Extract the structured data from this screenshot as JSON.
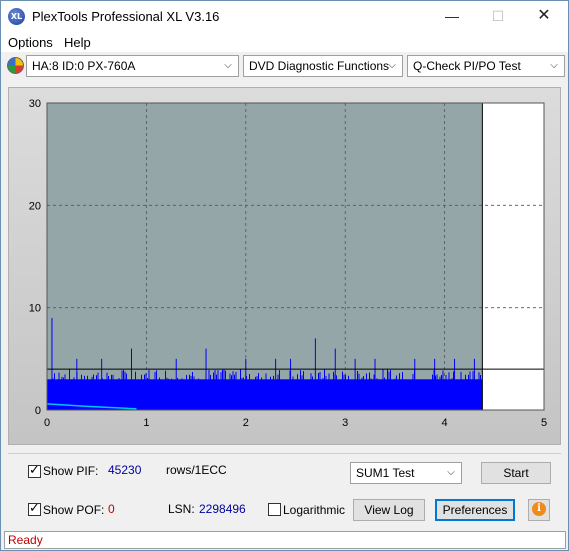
{
  "window": {
    "title": "PlexTools Professional XL V3.16",
    "icon_text": "XL",
    "minimize": "—",
    "maximize": "☐",
    "close": "✕"
  },
  "menu": {
    "options": "Options",
    "help": "Help"
  },
  "toolbar": {
    "drive": "HA:8 ID:0  PX-760A",
    "function": "DVD Diagnostic Functions",
    "test": "Q-Check PI/PO Test",
    "chevron": "⌵"
  },
  "chart_data": {
    "type": "bar",
    "title": "",
    "xlabel": "",
    "ylabel": "",
    "xlim": [
      0,
      5
    ],
    "ylim": [
      0,
      30
    ],
    "x_ticks": [
      "0",
      "1",
      "2",
      "3",
      "4",
      "5"
    ],
    "y_ticks": [
      "0",
      "10",
      "20",
      "30"
    ],
    "grid": true,
    "data_end_x": 4.38,
    "threshold_y": 4,
    "series": [
      {
        "color": "#0000ff",
        "baseline": 3,
        "typical_max": 4,
        "peaks": [
          [
            0.05,
            9
          ],
          [
            0.3,
            5
          ],
          [
            0.55,
            5
          ],
          [
            0.85,
            6
          ],
          [
            1.3,
            5
          ],
          [
            1.6,
            6
          ],
          [
            2.0,
            5
          ],
          [
            2.3,
            5
          ],
          [
            2.45,
            5
          ],
          [
            2.7,
            7
          ],
          [
            2.9,
            6
          ],
          [
            3.1,
            5
          ],
          [
            3.3,
            5
          ],
          [
            3.7,
            5
          ],
          [
            3.9,
            5
          ],
          [
            4.1,
            5
          ],
          [
            4.3,
            5
          ]
        ]
      },
      {
        "color": "#00c8ff",
        "baseline": 0.6,
        "end_x": 0.9
      }
    ],
    "plot_bg": "#94a6a8",
    "empty_bg": "#ffffff"
  },
  "controls": {
    "show_pif_label": "Show PIF:",
    "pif_value": "45230",
    "pif_unit": "rows/1ECC",
    "show_pof_label": "Show POF:",
    "pof_value": "0",
    "lsn_label": "LSN:",
    "lsn_value": "2298496",
    "logarithmic_label": "Logarithmic",
    "sum_select": "SUM1 Test",
    "start_button": "Start",
    "view_log_button": "View Log",
    "preferences_button": "Preferences",
    "info_icon": "i",
    "pif_checked": true,
    "pof_checked": true,
    "log_checked": false
  },
  "status": {
    "text": "Ready"
  }
}
